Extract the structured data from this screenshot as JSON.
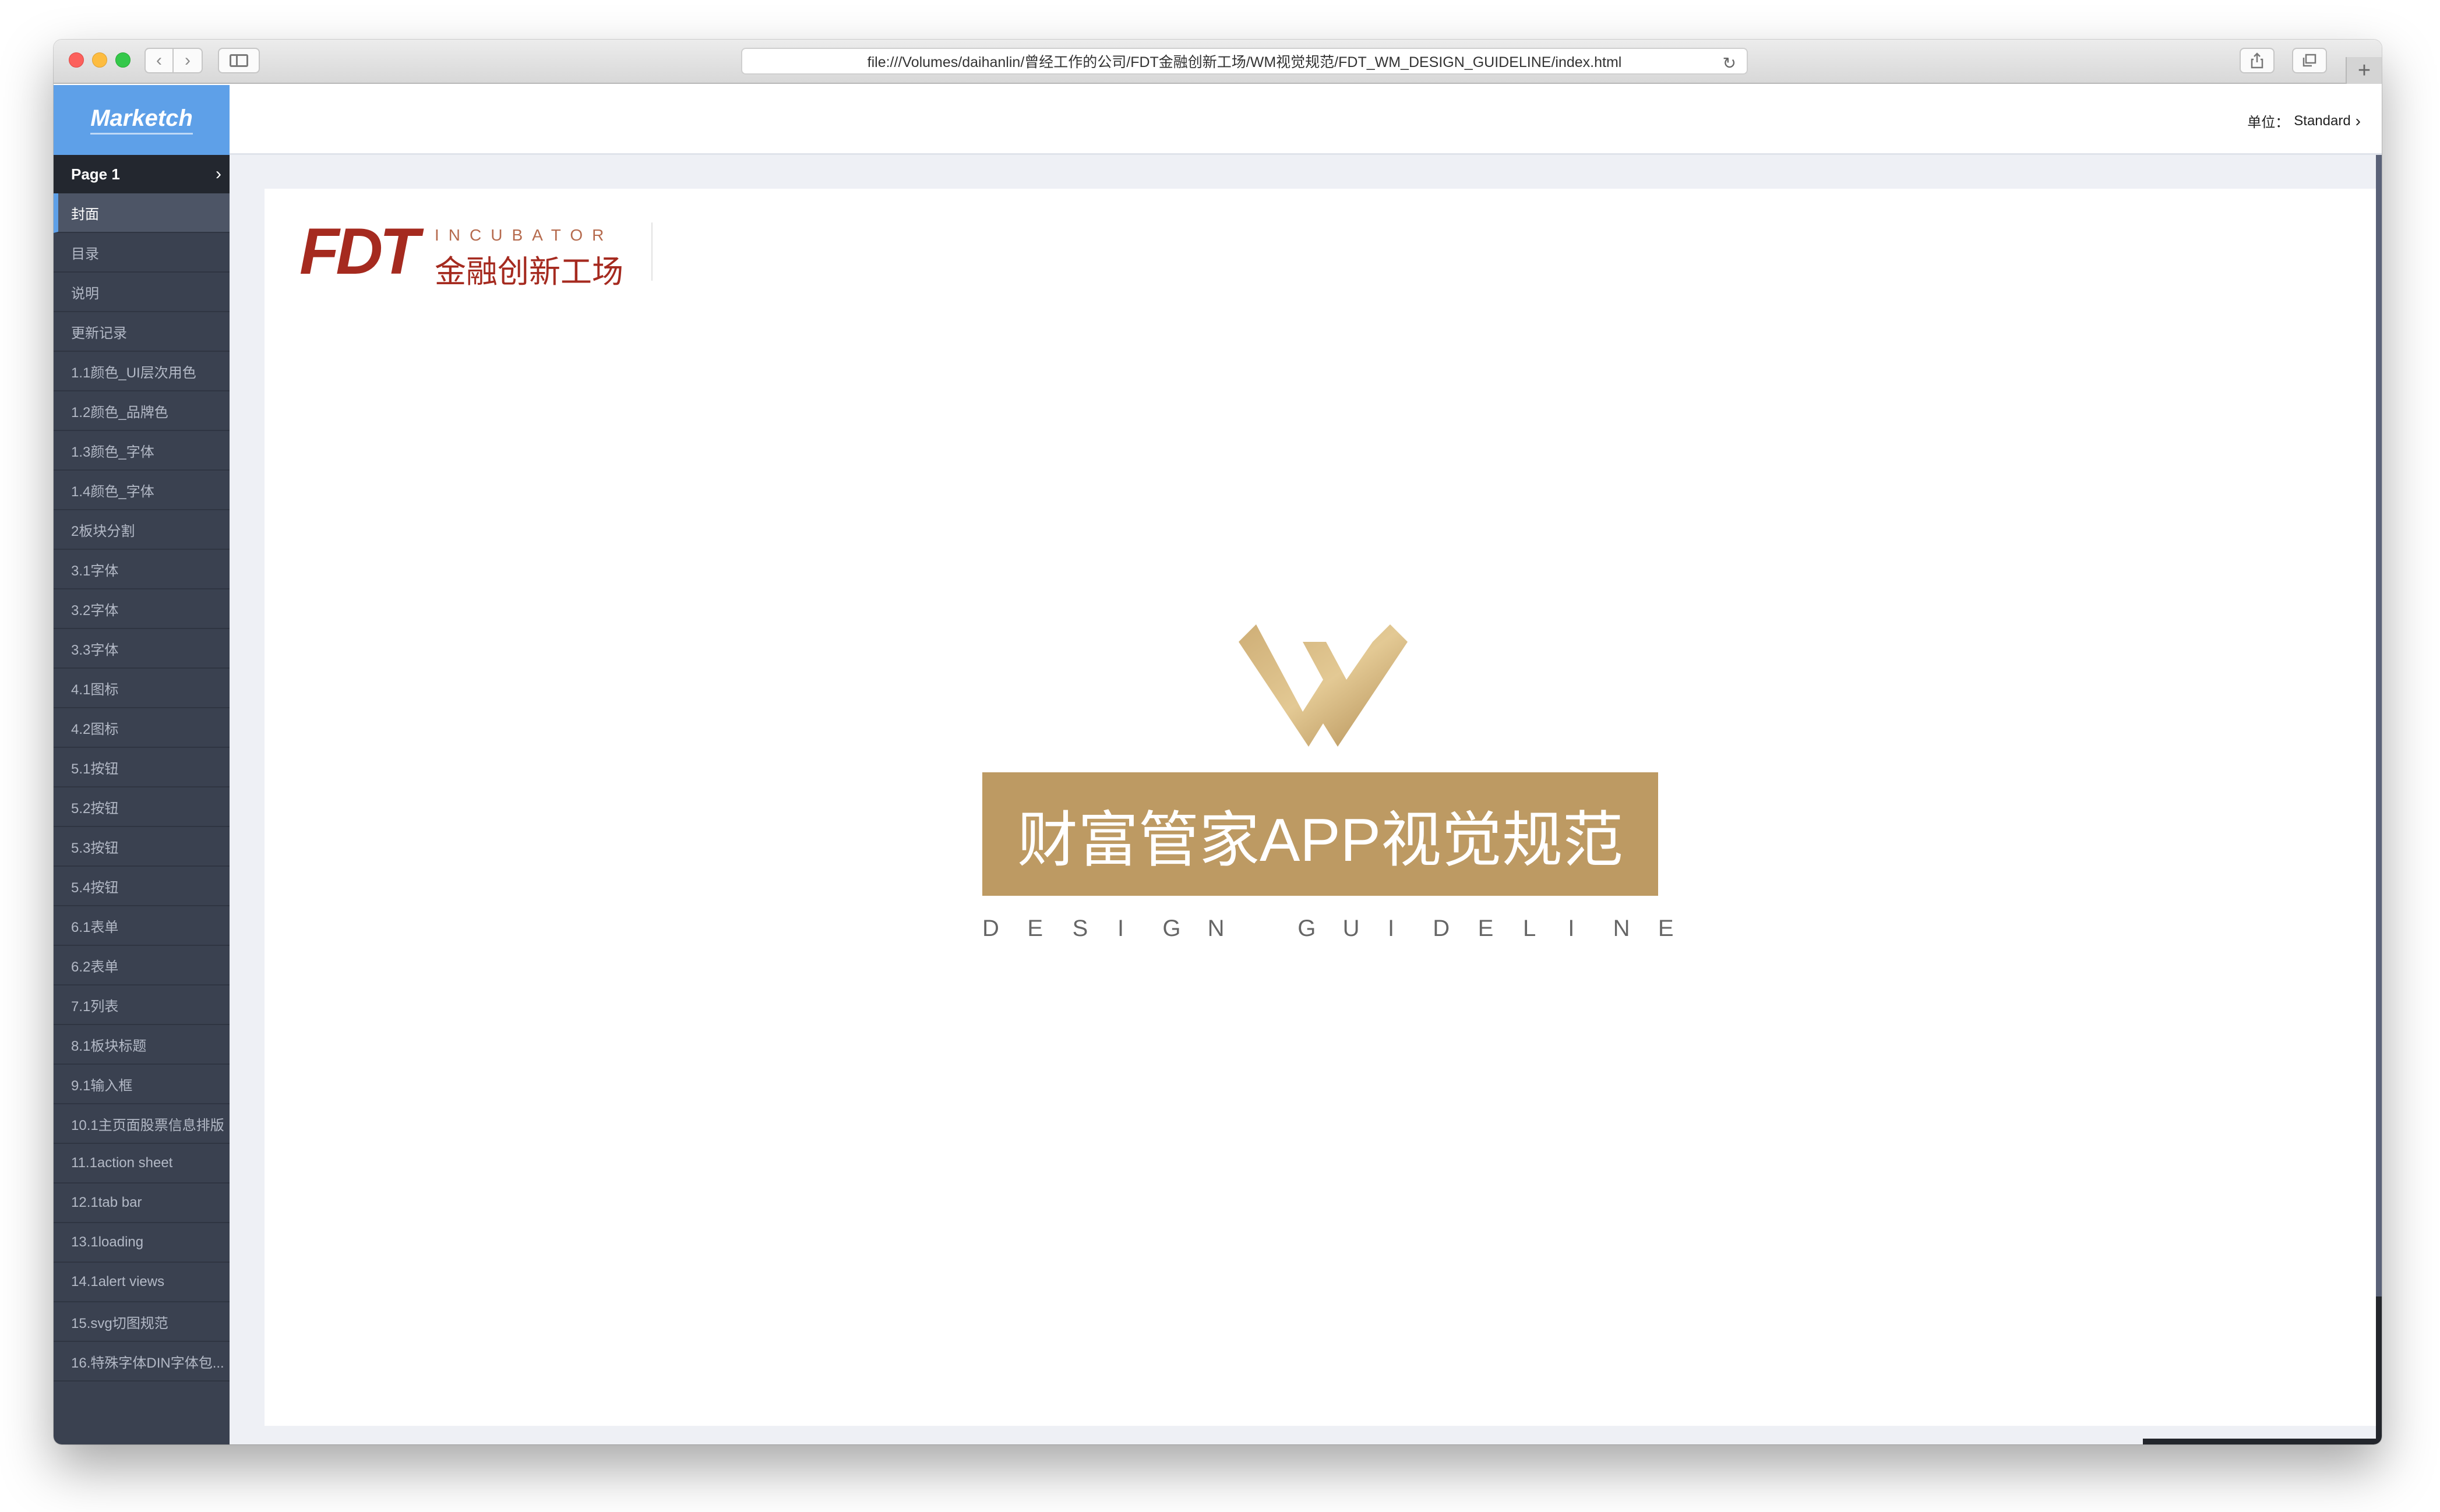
{
  "browser": {
    "url": "file:///Volumes/daihanlin/曾经工作的公司/FDT金融创新工场/WM视觉规范/FDT_WM_DESIGN_GUIDELINE/index.html"
  },
  "app": {
    "brand": "Marketch",
    "page_selector": "Page 1",
    "unit_label": "单位：",
    "unit_value": "Standard"
  },
  "nav": {
    "items": [
      {
        "label": "封面"
      },
      {
        "label": "目录"
      },
      {
        "label": "说明"
      },
      {
        "label": "更新记录"
      },
      {
        "label": "1.1颜色_UI层次用色"
      },
      {
        "label": "1.2颜色_品牌色"
      },
      {
        "label": "1.3颜色_字体"
      },
      {
        "label": "1.4颜色_字体"
      },
      {
        "label": "2板块分割"
      },
      {
        "label": "3.1字体"
      },
      {
        "label": "3.2字体"
      },
      {
        "label": "3.3字体"
      },
      {
        "label": "4.1图标"
      },
      {
        "label": "4.2图标"
      },
      {
        "label": "5.1按钮"
      },
      {
        "label": "5.2按钮"
      },
      {
        "label": "5.3按钮"
      },
      {
        "label": "5.4按钮"
      },
      {
        "label": "6.1表单"
      },
      {
        "label": "6.2表单"
      },
      {
        "label": "7.1列表"
      },
      {
        "label": "8.1板块标题"
      },
      {
        "label": "9.1输入框"
      },
      {
        "label": "10.1主页面股票信息排版"
      },
      {
        "label": "11.1action sheet"
      },
      {
        "label": "12.1tab bar"
      },
      {
        "label": "13.1loading"
      },
      {
        "label": "14.1alert views"
      },
      {
        "label": "15.svg切图规范"
      },
      {
        "label": "16.特殊字体DIN字体包..."
      }
    ],
    "active_index": 0
  },
  "artboard": {
    "logo_letters": "FDT",
    "logo_incubator": "INCUBATOR",
    "logo_cn": "金融创新工场",
    "title": "财富管家APP视觉规范",
    "subtitle_letters": [
      "D",
      "E",
      "S",
      "I",
      "G",
      "N",
      " ",
      "G",
      "U",
      "I",
      "D",
      "E",
      "L",
      "I",
      "N",
      "E"
    ]
  },
  "colors": {
    "brand_blue": "#5ea0e8",
    "sidebar_bg": "#3a4150",
    "gold": "#bd9a63",
    "fdt_red": "#a52a1f"
  },
  "icons": {
    "back": "chevron-left-icon",
    "forward": "chevron-right-icon",
    "reload": "reload-icon",
    "share": "share-icon",
    "tabs": "tabs-icon",
    "new_tab": "plus-icon"
  }
}
